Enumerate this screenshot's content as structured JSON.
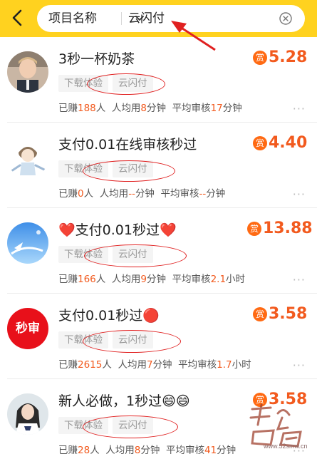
{
  "header": {
    "category_label": "项目名称",
    "search_value": "云闪付"
  },
  "colors": {
    "accent": "#ffd21f",
    "price": "#f25a1e",
    "badge": "#ff6a13",
    "annotation": "#e02020"
  },
  "tasks": [
    {
      "title": "3秒一杯奶茶",
      "tags": [
        "下载体验",
        "云闪付"
      ],
      "reward_badge": "赏",
      "price": "5.28",
      "earned_label": "已赚",
      "earned": "188",
      "earned_unit": "人",
      "avg_time_label": "人均用",
      "avg_time": "8",
      "avg_time_unit": "分钟",
      "review_label": "平均审核",
      "review_time": "17",
      "review_unit": "分钟"
    },
    {
      "title": "支付0.01在线审核秒过",
      "tags": [
        "下载体验",
        "云闪付"
      ],
      "reward_badge": "赏",
      "price": "4.40",
      "earned_label": "已赚",
      "earned": "0",
      "earned_unit": "人",
      "avg_time_label": "人均用",
      "avg_time": "--",
      "avg_time_unit": "分钟",
      "review_label": "平均审核",
      "review_time": "--",
      "review_unit": "分钟"
    },
    {
      "title": "❤️支付0.01秒过❤️",
      "tags": [
        "下载体验",
        "云闪付"
      ],
      "reward_badge": "赏",
      "price": "13.88",
      "earned_label": "已赚",
      "earned": "166",
      "earned_unit": "人",
      "avg_time_label": "人均用",
      "avg_time": "9",
      "avg_time_unit": "分钟",
      "review_label": "平均审核",
      "review_time": "2.1",
      "review_unit": "小时"
    },
    {
      "title": "支付0.01秒过🔴",
      "tags": [
        "下载体验",
        "云闪付"
      ],
      "reward_badge": "赏",
      "price": "3.58",
      "avatar_text": "秒审",
      "earned_label": "已赚",
      "earned": "2615",
      "earned_unit": "人",
      "avg_time_label": "人均用",
      "avg_time": "7",
      "avg_time_unit": "分钟",
      "review_label": "平均审核",
      "review_time": "1.7",
      "review_unit": "小时"
    },
    {
      "title": "新人必做，1秒过😄😄",
      "tags": [
        "下载体验",
        "云闪付"
      ],
      "reward_badge": "赏",
      "price": "3.58",
      "earned_label": "已赚",
      "earned": "28",
      "earned_unit": "人",
      "avg_time_label": "人均用",
      "avg_time": "8",
      "avg_time_unit": "分钟",
      "review_label": "平均审核",
      "review_time": "41",
      "review_unit": "分钟"
    }
  ],
  "more_glyph": "···",
  "watermark": {
    "text": "www.52smw.cn"
  }
}
